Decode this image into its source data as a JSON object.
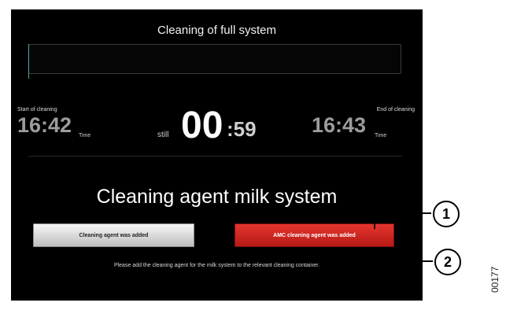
{
  "screen": {
    "title": "Cleaning of full system",
    "progress_fraction": 0.0,
    "start": {
      "label": "Start of cleaning",
      "time": "16:42",
      "unit": "Time"
    },
    "still_label": "still",
    "countdown": {
      "minutes": "00",
      "seconds": ":59"
    },
    "end": {
      "label": "End of cleaning",
      "time": "16:43",
      "unit": "Time"
    },
    "heading": "Cleaning agent milk system",
    "buttons": {
      "agent_added": "Cleaning agent was added",
      "amc_agent_added": "AMC cleaning agent was added"
    },
    "hint": "Please add the cleaning agent for the milk system to the relevant cleaning container."
  },
  "callouts": {
    "one": "1",
    "two": "2"
  },
  "figure_id": "00177",
  "colors": {
    "background": "#000000",
    "accent_red": "#d0241f",
    "progress": "#3ea4a4",
    "button_grey": "#d8d8d8"
  }
}
